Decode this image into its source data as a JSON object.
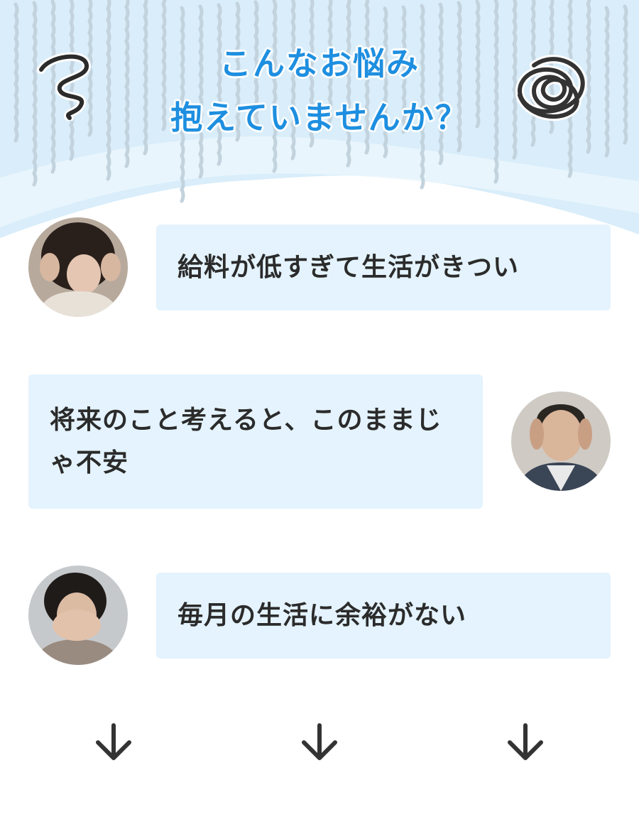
{
  "header": {
    "headline_line1": "こんなお悩み",
    "headline_line2": "抱えていませんか？"
  },
  "worries": [
    {
      "text": "給料が低すぎて生活がきつい",
      "avatar": "worried-woman-holding-head"
    },
    {
      "text": "将来のこと考えると、このままじゃ不安",
      "avatar": "stressed-man-temples"
    },
    {
      "text": "毎月の生活に余裕がない",
      "avatar": "woman-covering-face"
    }
  ],
  "icons": {
    "left_deco": "spiral-icon",
    "right_deco": "scribble-icon",
    "arrows": [
      "arrow-down-icon",
      "arrow-down-icon",
      "arrow-down-icon"
    ]
  },
  "colors": {
    "headline": "#1e8fe0",
    "bubble": "#e4f3fd",
    "sky": "#d9edfa",
    "text": "#2b2b2b"
  }
}
